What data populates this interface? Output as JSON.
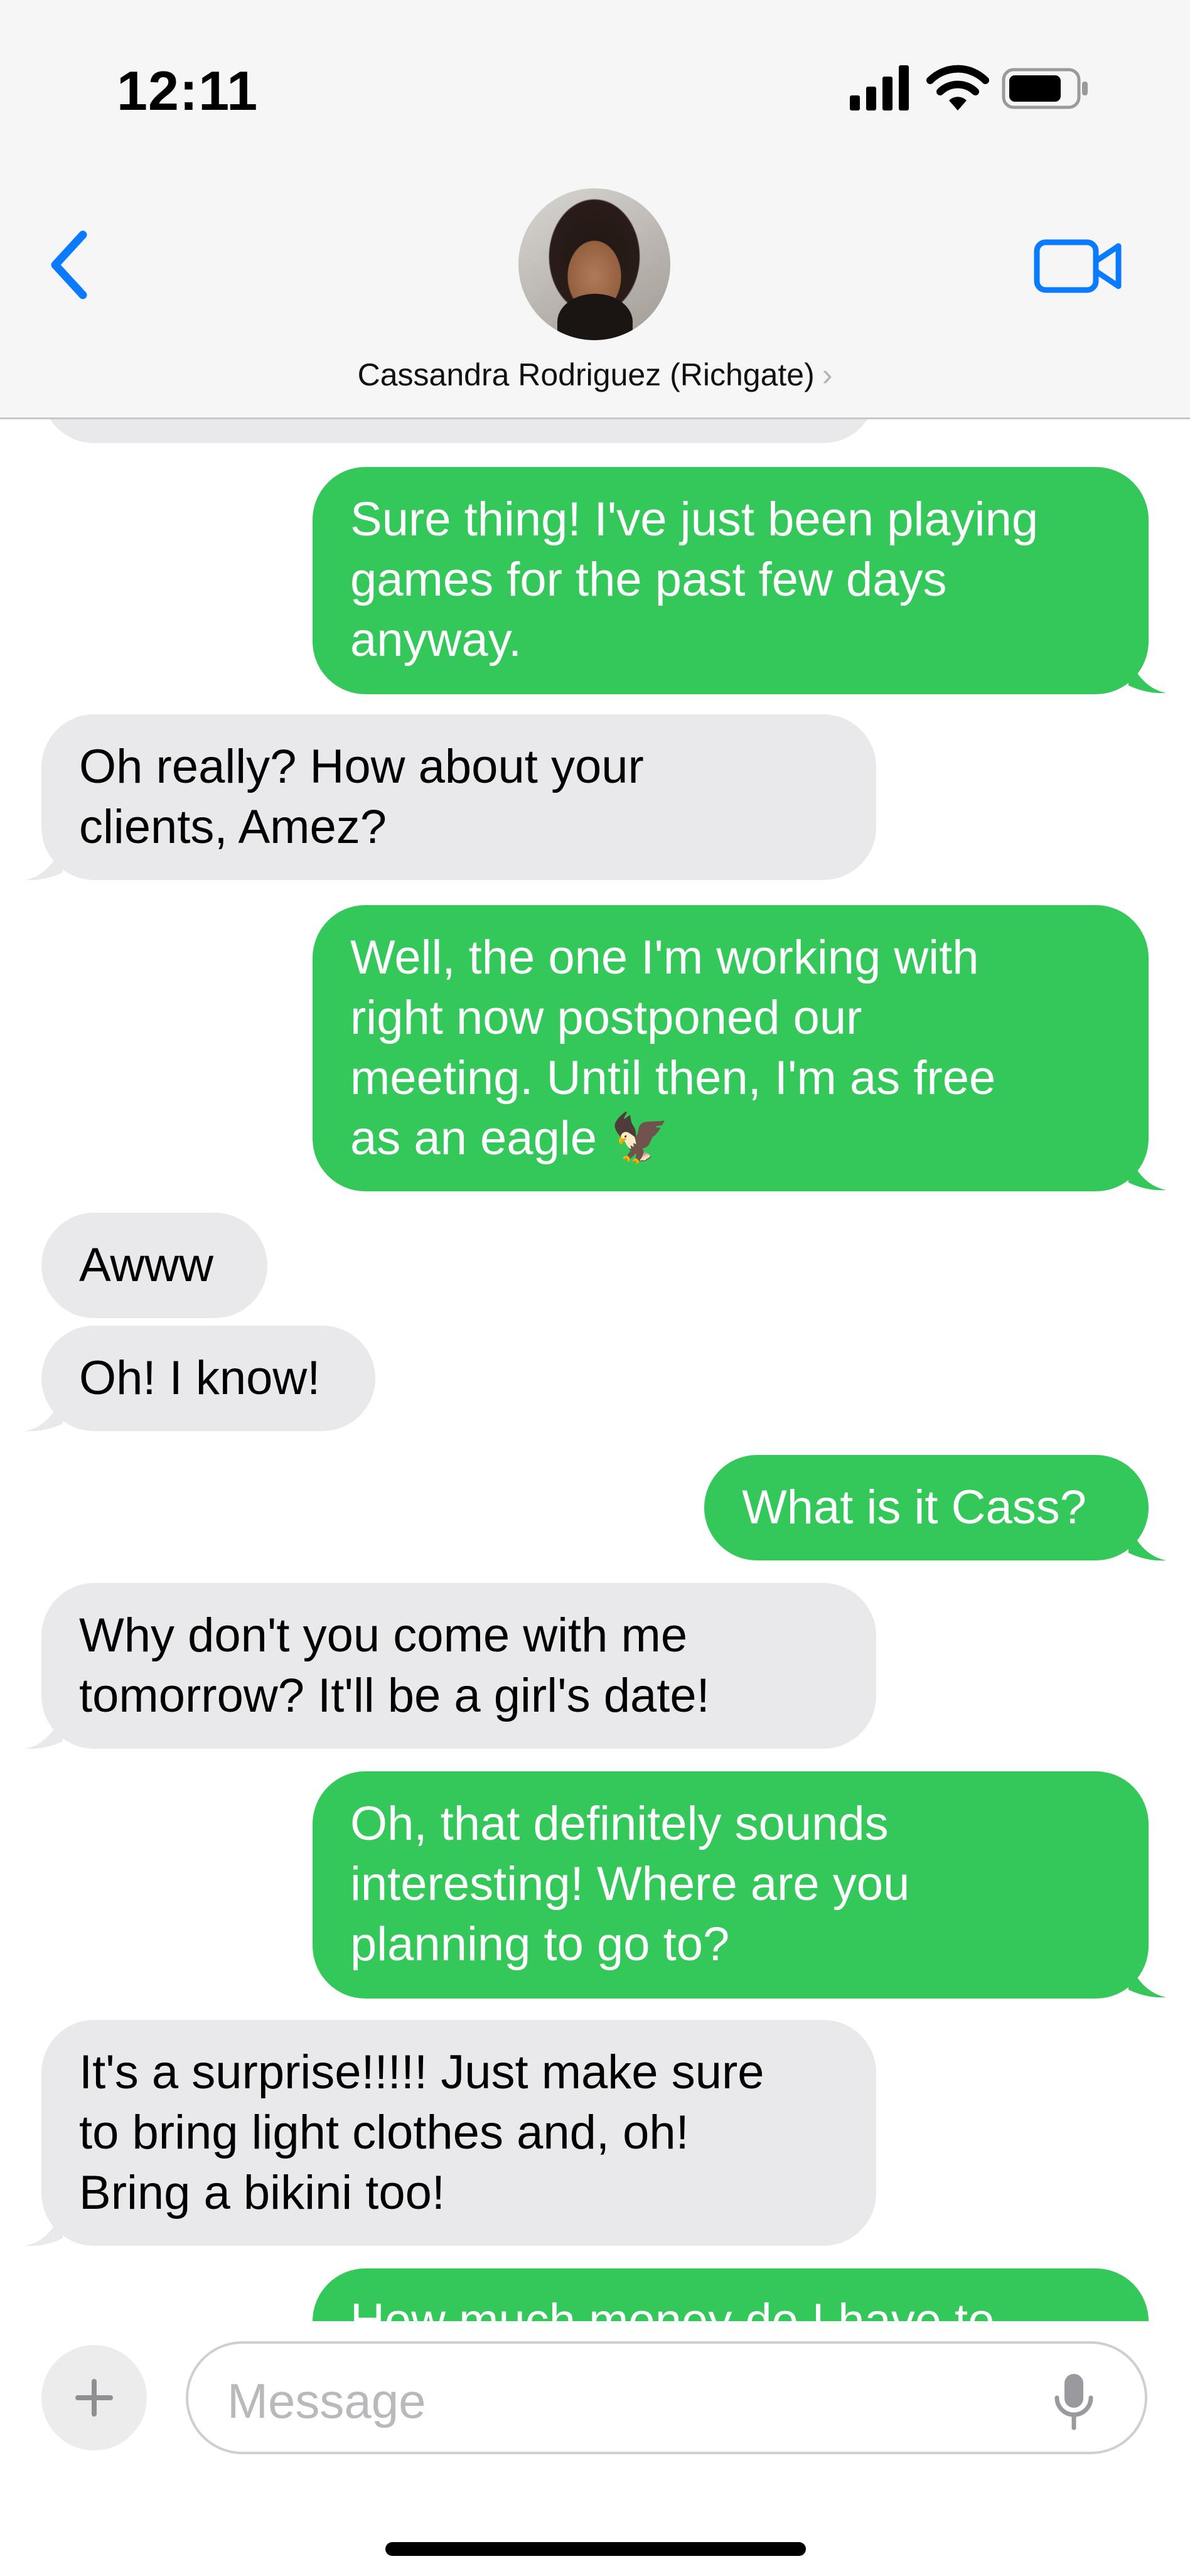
{
  "status_bar": {
    "time": "12:11"
  },
  "header": {
    "contact_name": "Cassandra Rodriguez (Richgate)",
    "chevron": "›",
    "back_icon": "chevron-left-icon",
    "video_icon": "video-camera-icon"
  },
  "colors": {
    "outgoing_bubble": "#34c759",
    "incoming_bubble": "#e9e9eb",
    "accent": "#0a7aff"
  },
  "messages": [
    {
      "direction": "out",
      "text": "Sure thing! I've just been playing\ngames for the past few days\nanyway."
    },
    {
      "direction": "in",
      "text": "Oh really? How about your\nclients, Amez?"
    },
    {
      "direction": "out",
      "text": "Well, the one I'm working with\nright now postponed our\nmeeting. Until then, I'm as free\nas an eagle 🦅"
    },
    {
      "direction": "in",
      "text": "Awww"
    },
    {
      "direction": "in",
      "text": "Oh! I know!"
    },
    {
      "direction": "out",
      "text": "What is it Cass?"
    },
    {
      "direction": "in",
      "text": "Why don't you come with me\ntomorrow? It'll be a girl's date!"
    },
    {
      "direction": "out",
      "text": "Oh, that definitely sounds\ninteresting! Where are you\nplanning to go to?"
    },
    {
      "direction": "in",
      "text": "It's a surprise!!!!! Just make sure\nto bring light clothes and, oh!\nBring a bikini too!"
    },
    {
      "direction": "out",
      "text": "How much money do I have to"
    }
  ],
  "composer": {
    "placeholder": "Message",
    "plus_icon": "plus-icon",
    "mic_icon": "microphone-icon"
  }
}
